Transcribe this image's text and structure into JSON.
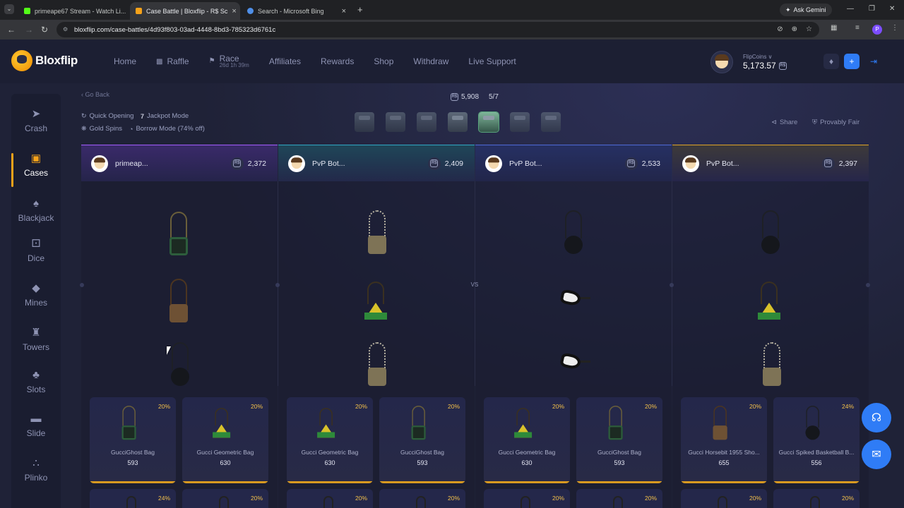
{
  "browser": {
    "tabs": [
      {
        "title": "primeape67 Stream - Watch Li...",
        "color": "#53fc18",
        "active": false
      },
      {
        "title": "Case Battle | Bloxflip - R$ Sc",
        "color": "#f6a21a",
        "active": true
      },
      {
        "title": "Search - Microsoft Bing",
        "color": "#4f8fe8",
        "active": false
      }
    ],
    "url": "bloxflip.com/case-battles/4d93f803-03ad-4448-8bd3-785323d6761c",
    "ask_gemini": "Ask Gemini",
    "profile_initial": "P"
  },
  "site": {
    "logo_text": "Bloxflip",
    "nav": {
      "home": "Home",
      "raffle": "Raffle",
      "race": "Race",
      "race_timer": "26d 1h 39m",
      "affiliates": "Affiliates",
      "rewards": "Rewards",
      "shop": "Shop",
      "withdraw": "Withdraw",
      "live_support": "Live Support"
    },
    "balance_label": "FlipCoins ∨",
    "balance_value": "5,173.57",
    "brand_color": "#f6a21a",
    "accent_color": "#2f7cf6"
  },
  "sidebar": {
    "items": [
      {
        "label": "Crash",
        "icon": "rocket-icon"
      },
      {
        "label": "Cases",
        "icon": "case-icon",
        "active": true
      },
      {
        "label": "Blackjack",
        "icon": "cards-icon"
      },
      {
        "label": "Dice",
        "icon": "dice-icon"
      },
      {
        "label": "Mines",
        "icon": "diamond-icon"
      },
      {
        "label": "Towers",
        "icon": "tower-icon"
      },
      {
        "label": "Slots",
        "icon": "slots-icon"
      },
      {
        "label": "Slide",
        "icon": "slide-icon"
      },
      {
        "label": "Plinko",
        "icon": "plinko-icon"
      }
    ]
  },
  "battle": {
    "go_back": "‹ Go Back",
    "cost": "5,908",
    "round": "5/7",
    "options": {
      "quick_opening": "Quick Opening",
      "jackpot_mode": "Jackpot Mode",
      "gold_spins": "Gold Spins",
      "borrow_mode": "Borrow Mode (74% off)"
    },
    "share": "Share",
    "provably_fair": "Provably Fair",
    "vs": "VS",
    "players": [
      {
        "name": "primeap...",
        "value": "2,372",
        "accent": "#a35cff"
      },
      {
        "name": "PvP Bot...",
        "value": "2,409",
        "accent": "#2fa8c4"
      },
      {
        "name": "PvP Bot...",
        "value": "2,533",
        "accent": "#4f6ad8"
      },
      {
        "name": "PvP Bot...",
        "value": "2,397",
        "accent": "#e0a526"
      }
    ],
    "cards": [
      {
        "name": "GucciGhost Bag",
        "value": "593",
        "pct": "20%"
      },
      {
        "name": "Gucci Geometric Bag",
        "value": "630",
        "pct": "20%"
      },
      {
        "name": "Gucci Geometric Bag",
        "value": "630",
        "pct": "20%"
      },
      {
        "name": "GucciGhost Bag",
        "value": "593",
        "pct": "20%"
      },
      {
        "name": "Gucci Geometric Bag",
        "value": "630",
        "pct": "20%"
      },
      {
        "name": "GucciGhost Bag",
        "value": "593",
        "pct": "20%"
      },
      {
        "name": "Gucci Horsebit 1955 Sho...",
        "value": "655",
        "pct": "20%"
      },
      {
        "name": "Gucci Spiked Basketball B...",
        "value": "556",
        "pct": "24%"
      }
    ],
    "next_row_pcts": [
      "24%",
      "20%",
      "20%",
      "20%",
      "20%",
      "20%",
      "20%",
      "20%"
    ]
  }
}
